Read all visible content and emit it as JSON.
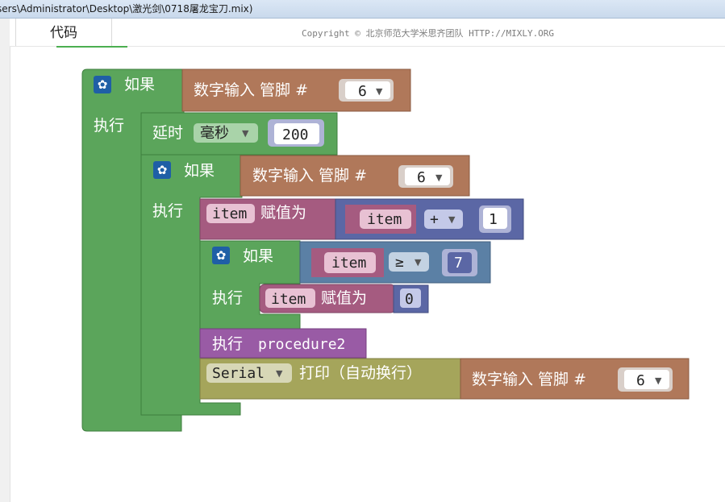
{
  "window": {
    "title": "sers\\Administrator\\Desktop\\激光剑\\0718屠龙宝刀.mix)"
  },
  "tabs": {
    "code_label": "代码"
  },
  "copyright": "Copyright © 北京师范大学米思齐团队 HTTP://MIXLY.ORG",
  "blocks": {
    "if_label": "如果",
    "do_label": "执行",
    "digital_read_label": "数字输入 管脚 #",
    "pin_value": "6",
    "delay_label": "延时",
    "delay_unit": "毫秒",
    "delay_value": "200",
    "var_name": "item",
    "assign_label": "赋值为",
    "plus_op": "+",
    "one_value": "1",
    "gte_op": "≥",
    "seven_value": "7",
    "zero_value": "0",
    "procedure_label": "执行",
    "procedure_name": "procedure2",
    "serial_label": "Serial",
    "print_label": "打印（自动换行）"
  },
  "colors": {
    "control_green": "#5ba55b",
    "io_brown": "#b0785a",
    "math_blue": "#5b67a5",
    "logic_blue": "#5b80a5",
    "variable_pink": "#a55b80",
    "procedure_purple": "#995ba5",
    "serial_olive": "#a5a55b"
  }
}
